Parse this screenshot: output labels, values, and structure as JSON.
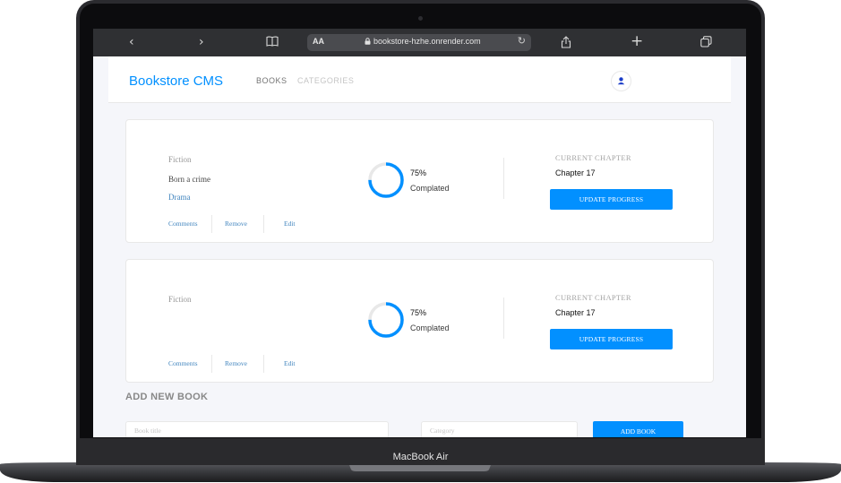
{
  "browser": {
    "url": "bookstore-hzhe.onrender.com",
    "text_size_label": "AA",
    "icons": {
      "back": "chevron-left-icon",
      "forward": "chevron-right-icon",
      "bookmarks": "book-icon",
      "reload": "reload-icon",
      "share": "share-icon",
      "new_tab": "plus-icon",
      "tabs": "tabs-icon"
    }
  },
  "header": {
    "brand": "Bookstore CMS",
    "nav": [
      "BOOKS",
      "CATEGORIES"
    ],
    "avatar_icon": "user-icon"
  },
  "books": [
    {
      "genre": "Fiction",
      "title": "Born a crime",
      "author": "Drama",
      "actions": [
        "Comments",
        "Remove",
        "Edit"
      ],
      "progress_percent": "75%",
      "progress_value": 0.75,
      "progress_label": "Complated",
      "chapter_label": "CURRENT CHAPTER",
      "chapter": "Chapter 17",
      "update_button": "UPDATE PROGRESS"
    },
    {
      "genre": "Fiction",
      "title": "",
      "author": "",
      "actions": [
        "Comments",
        "Remove",
        "Edit"
      ],
      "progress_percent": "75%",
      "progress_value": 0.75,
      "progress_label": "Complated",
      "chapter_label": "CURRENT CHAPTER",
      "chapter": "Chapter 17",
      "update_button": "UPDATE PROGRESS"
    }
  ],
  "add_form": {
    "title": "ADD NEW BOOK",
    "title_placeholder": "Book title",
    "category_placeholder": "Category",
    "button": "ADD BOOK"
  },
  "device": {
    "label": "MacBook Air"
  },
  "colors": {
    "accent": "#0290ff",
    "link": "#4386bf",
    "page_bg": "#f5f6fa"
  }
}
